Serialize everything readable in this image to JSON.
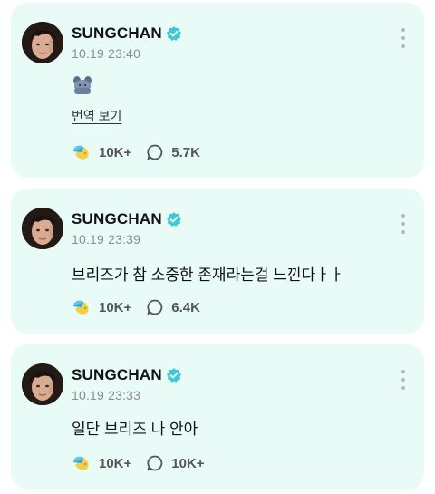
{
  "posts": [
    {
      "author": "SUNGCHAN",
      "time": "10.19 23:40",
      "emoji": "puppy-emoji",
      "translate_label": "번역 보기",
      "likes": "10K+",
      "comments": "5.7K"
    },
    {
      "author": "SUNGCHAN",
      "time": "10.19 23:39",
      "text": "브리즈가 참 소중한 존재라는걸 느낀다ㅏㅏ",
      "likes": "10K+",
      "comments": "6.4K"
    },
    {
      "author": "SUNGCHAN",
      "time": "10.19 23:33",
      "text": "일단 브리즈 나 안아",
      "likes": "10K+",
      "comments": "10K+"
    }
  ],
  "colors": {
    "card_background": "#e9fbf6",
    "verified_badge": "#3fc9d6",
    "like_icon_blue": "#5cc7ee",
    "like_icon_yellow": "#f2cf4a"
  },
  "icons": {
    "verified": "verified-badge-icon",
    "like": "like-icon",
    "comment": "comment-bubble-icon",
    "more": "more-vertical-icon"
  }
}
